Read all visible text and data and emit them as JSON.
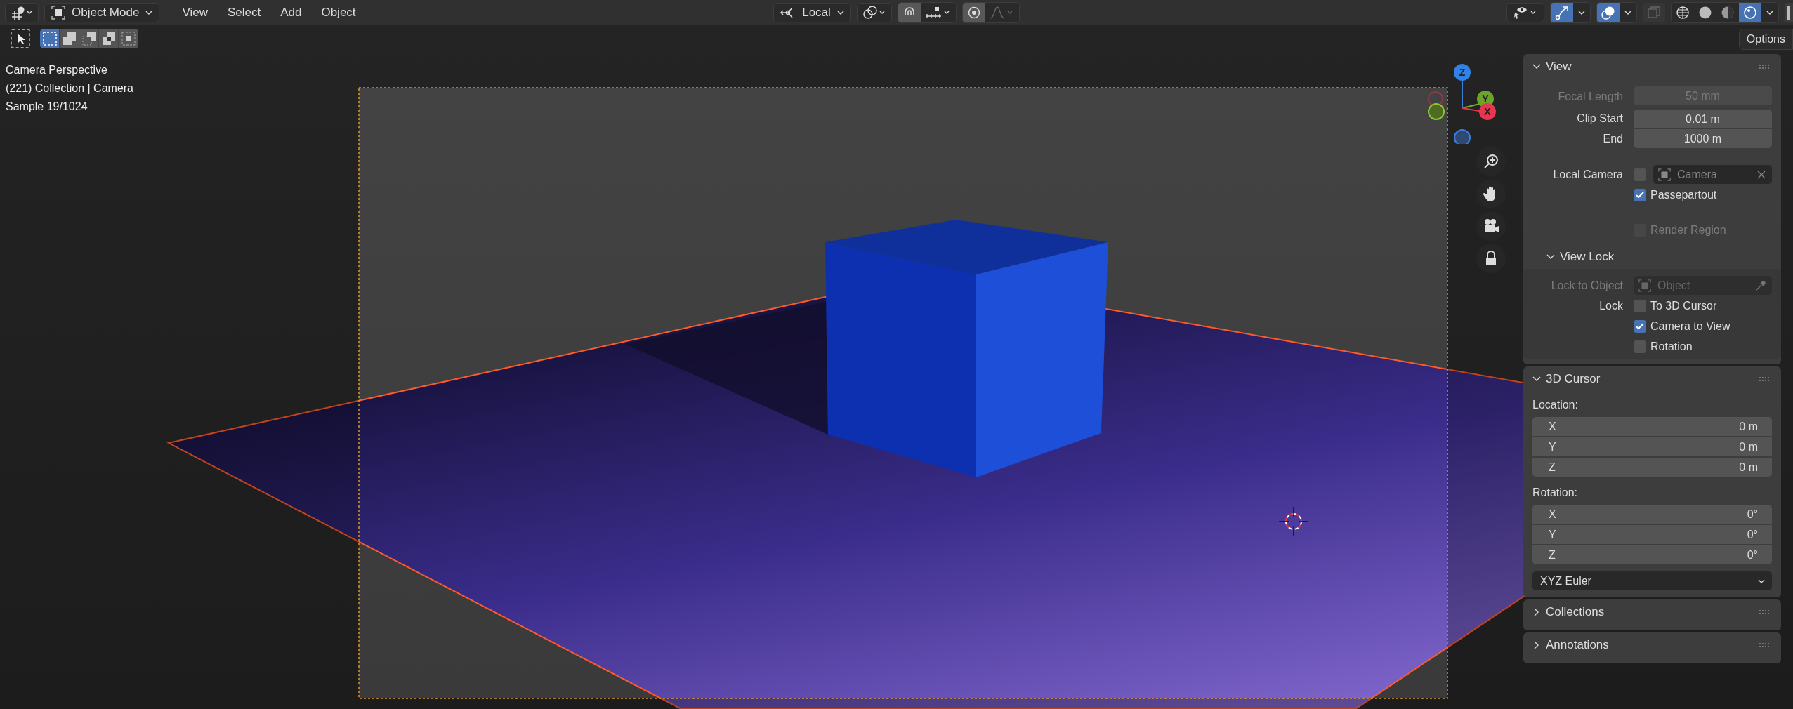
{
  "header": {
    "mode": "Object Mode",
    "menus": [
      "View",
      "Select",
      "Add",
      "Object"
    ],
    "pivot": "Local",
    "snapping": {
      "selected": true
    },
    "proportional_editing": {
      "selected": true
    },
    "falloff": {
      "disabled": true
    },
    "gizmos": {
      "selected": true
    },
    "overlays": {
      "selected": true
    },
    "xray": {
      "selected": false
    },
    "shading_modes": [
      {
        "selected": false
      },
      {
        "selected": false
      },
      {
        "selected": false
      },
      {
        "selected": true
      }
    ]
  },
  "toolbar": {
    "selection_modes": [
      {
        "selected": true
      },
      {
        "selected": false
      },
      {
        "selected": false
      },
      {
        "selected": false
      },
      {
        "selected": false
      }
    ],
    "options": "Options"
  },
  "viewport_info": [
    "Camera Perspective",
    "(221) Collection | Camera",
    "Sample 19/1024"
  ],
  "gizmo_axes": [
    "X",
    "Y",
    "Z"
  ],
  "view_panel": {
    "title": "View",
    "expanded": true,
    "fields": [
      {
        "label": "Focal Length",
        "value": "50 mm",
        "disabled": true
      },
      {
        "label": "Clip Start",
        "value": "0.01 m",
        "disabled": false
      },
      {
        "label": "End",
        "value": "1000 m",
        "disabled": false
      }
    ],
    "local_camera": {
      "label": "Local Camera",
      "checked": false,
      "value": "Camera"
    },
    "passepartout": {
      "label": "Passepartout",
      "checked": true
    },
    "render_region": {
      "label": "Render Region",
      "checked": false,
      "disabled": true
    },
    "view_lock": {
      "title": "View Lock",
      "expanded": true,
      "lock_to_object": {
        "label": "Lock to Object",
        "placeholder": "Object",
        "disabled": true
      },
      "lock_label": "Lock",
      "locks": [
        {
          "label": "To 3D Cursor",
          "checked": false
        },
        {
          "label": "Camera to View",
          "checked": true
        },
        {
          "label": "Rotation",
          "checked": false
        }
      ]
    }
  },
  "cursor_panel": {
    "title": "3D Cursor",
    "expanded": true,
    "location_label": "Location:",
    "location": [
      {
        "axis": "X",
        "value": "0 m"
      },
      {
        "axis": "Y",
        "value": "0 m"
      },
      {
        "axis": "Z",
        "value": "0 m"
      }
    ],
    "rotation_label": "Rotation:",
    "rotation": [
      {
        "axis": "X",
        "value": "0°"
      },
      {
        "axis": "Y",
        "value": "0°"
      },
      {
        "axis": "Z",
        "value": "0°"
      }
    ],
    "rotation_mode": "XYZ Euler"
  },
  "collapsed_panels": [
    {
      "title": "Collections",
      "expanded": false
    },
    {
      "title": "Annotations",
      "expanded": false
    }
  ]
}
